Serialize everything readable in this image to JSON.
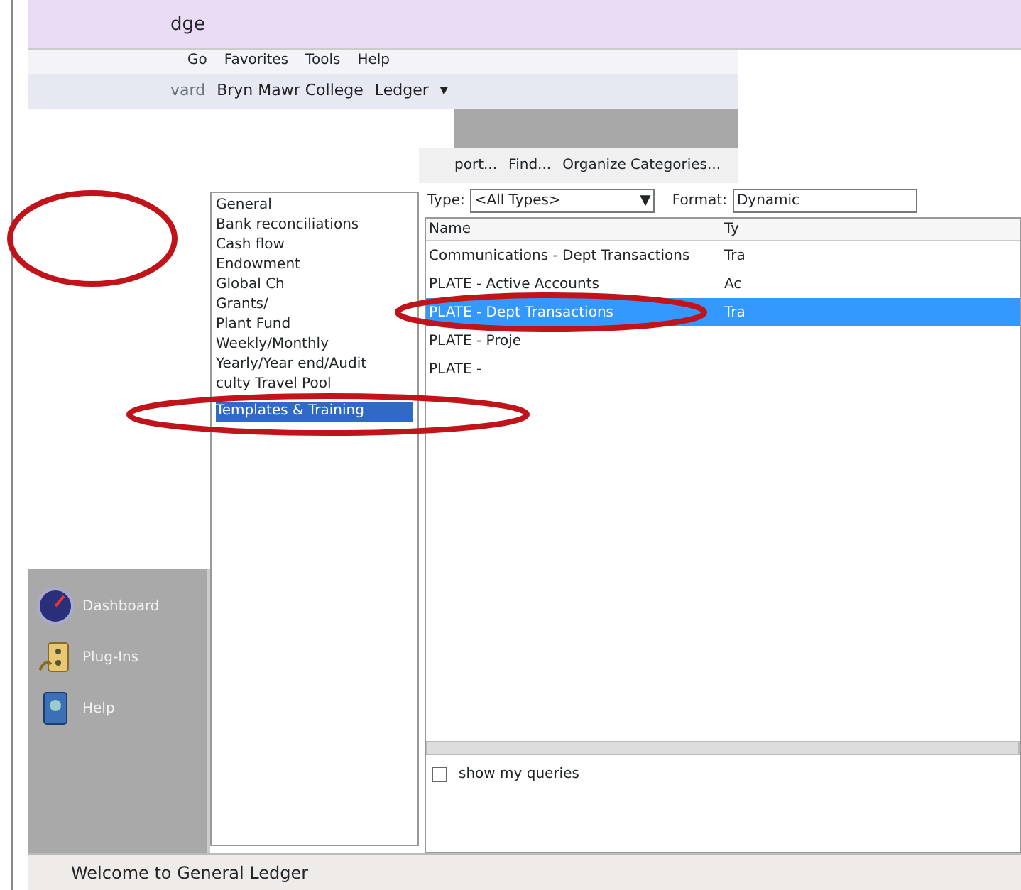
{
  "window": {
    "title": "dge"
  },
  "menu": [
    "Go",
    "Favorites",
    "Tools",
    "Help"
  ],
  "address_bar": {
    "back": "vard",
    "path": [
      "Bryn Mawr College",
      "Ledger"
    ],
    "caret": "▾"
  },
  "toolbar": [
    "port...",
    "Find...",
    "Organize Categories..."
  ],
  "categories": [
    {
      "label": "General",
      "selected": false
    },
    {
      "label": "Bank reconciliations",
      "selected": false
    },
    {
      "label": "Cash flow",
      "selected": false
    },
    {
      "label": "Endowment",
      "selected": false
    },
    {
      "label": "Global Ch",
      "selected": false
    },
    {
      "label": "Grants/",
      "selected": false
    },
    {
      "label": "Plant Fund",
      "selected": false
    },
    {
      "label": "Weekly/Monthly",
      "selected": false
    },
    {
      "label": "Yearly/Year end/Audit",
      "selected": false
    },
    {
      "label": "culty Travel Pool",
      "selected": false
    },
    {
      "label": "Templates & Training",
      "selected": true
    }
  ],
  "filters": {
    "type_label": "Type:",
    "type_value": "<All Types>",
    "type_arrow": "▼",
    "format_label": "Format:",
    "format_value": "Dynamic"
  },
  "queries": {
    "columns": [
      "Name",
      "Ty"
    ],
    "rows": [
      {
        "cells": [
          "Communications - Dept Transactions",
          "Tra"
        ],
        "selected": false
      },
      {
        "cells": [
          "PLATE - Active Accounts",
          "Ac"
        ],
        "selected": false
      },
      {
        "cells": [
          "PLATE - Dept Transactions",
          "Tra"
        ],
        "selected": true
      },
      {
        "cells": [
          "PLATE - Proje",
          ""
        ],
        "selected": false
      },
      {
        "cells": [
          "PLATE -",
          ""
        ],
        "selected": false
      }
    ]
  },
  "navigation": [
    {
      "label": "Dashboard",
      "kind": "gauge"
    },
    {
      "label": "Plug-Ins",
      "kind": "plug"
    },
    {
      "label": "Help",
      "kind": "book"
    }
  ],
  "show_my_queries": {
    "label": "show my queries",
    "checked": false
  },
  "status_bar": "Welcome to General Ledger",
  "annotations": [
    {
      "kind": "ellipse"
    },
    {
      "kind": "ellipse"
    },
    {
      "kind": "ellipse"
    }
  ]
}
